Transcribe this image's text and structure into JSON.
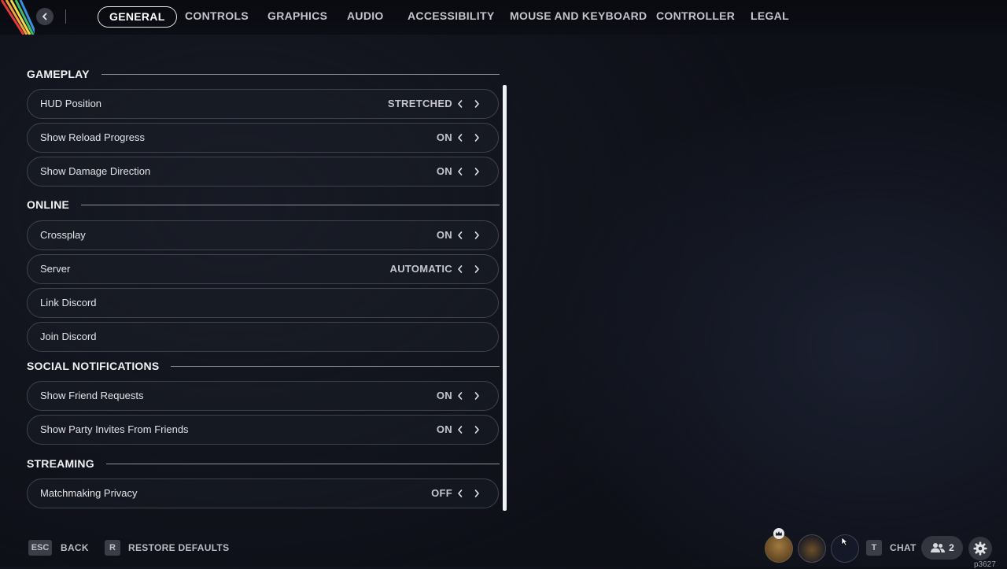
{
  "tabs": [
    {
      "label": "GENERAL",
      "active": true
    },
    {
      "label": "CONTROLS",
      "active": false
    },
    {
      "label": "GRAPHICS",
      "active": false
    },
    {
      "label": "AUDIO",
      "active": false
    },
    {
      "label": "ACCESSIBILITY",
      "active": false
    },
    {
      "label": "MOUSE AND KEYBOARD",
      "active": false
    },
    {
      "label": "CONTROLLER",
      "active": false
    },
    {
      "label": "LEGAL",
      "active": false
    }
  ],
  "sections": [
    {
      "title": "GAMEPLAY"
    },
    {
      "title": "ONLINE"
    },
    {
      "title": "SOCIAL NOTIFICATIONS"
    },
    {
      "title": "STREAMING"
    }
  ],
  "rows": [
    {
      "label": "HUD Position",
      "value": "STRETCHED"
    },
    {
      "label": "Show Reload Progress",
      "value": "ON"
    },
    {
      "label": "Show Damage Direction",
      "value": "ON"
    },
    {
      "label": "Crossplay",
      "value": "ON"
    },
    {
      "label": "Server",
      "value": "AUTOMATIC"
    },
    {
      "label": "Link Discord",
      "value": ""
    },
    {
      "label": "Join Discord",
      "value": ""
    },
    {
      "label": "Show Friend Requests",
      "value": "ON"
    },
    {
      "label": "Show Party Invites From Friends",
      "value": "ON"
    },
    {
      "label": "Matchmaking Privacy",
      "value": "OFF"
    }
  ],
  "footer": {
    "back_key": "ESC",
    "back_label": "BACK",
    "restore_key": "R",
    "restore_label": "RESTORE DEFAULTS",
    "chat_key": "T",
    "chat_label": "CHAT",
    "friends_count": "2",
    "build": "p3627"
  },
  "icons": {
    "back": "chevron-left-icon",
    "prev": "chevron-left-icon",
    "next": "chevron-right-icon",
    "friends": "friends-icon",
    "settings": "gear-icon",
    "crown": "crown-icon"
  },
  "colors": {
    "background": "#0e1018",
    "text": "#e6e7ea",
    "stripe_1": "#e23b3b",
    "stripe_2": "#f2a33a",
    "stripe_3": "#f0d84a",
    "stripe_4": "#3fbf6c",
    "stripe_5": "#3b8fe0"
  }
}
